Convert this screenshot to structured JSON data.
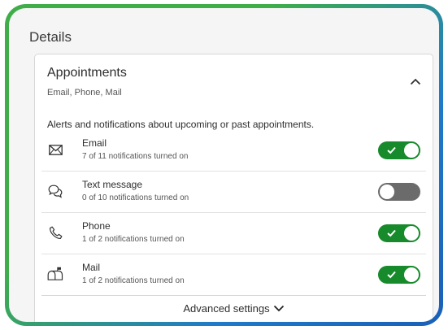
{
  "section_title": "Details",
  "card": {
    "title": "Appointments",
    "subtitle": "Email, Phone, Mail",
    "description": "Alerts and notifications about upcoming or past appointments.",
    "collapse_icon": "chevron-up-icon",
    "rows": [
      {
        "label": "Email",
        "sub": "7 of 11 notifications turned on",
        "icon": "envelope-icon",
        "on": true
      },
      {
        "label": "Text message",
        "sub": "0 of 10 notifications turned on",
        "icon": "chat-bubbles-icon",
        "on": false
      },
      {
        "label": "Phone",
        "sub": "1 of 2 notifications turned on",
        "icon": "phone-icon",
        "on": true
      },
      {
        "label": "Mail",
        "sub": "1 of 2 notifications turned on",
        "icon": "mailbox-icon",
        "on": true
      }
    ],
    "advanced_label": "Advanced settings"
  },
  "colors": {
    "toggle_on": "#178a2b",
    "toggle_off": "#6b6b6b",
    "border_green": "#3fae49",
    "border_blue": "#1a5fb8"
  }
}
